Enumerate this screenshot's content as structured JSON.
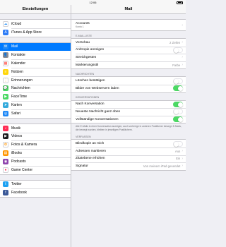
{
  "status": {
    "time": "12:06"
  },
  "sidebar": {
    "title": "Einstellungen",
    "groups": [
      [
        {
          "label": "iCloud",
          "color": "#ffffff",
          "icon": "cloud-icon",
          "glyph": "☁",
          "fg": "#3f9cf6"
        },
        {
          "label": "iTunes & App Store",
          "color": "#2e7cf6",
          "icon": "app-store-icon",
          "glyph": "A",
          "fg": "#ffffff"
        }
      ],
      [
        {
          "label": "Mail",
          "color": "#1e88f7",
          "icon": "mail-icon",
          "glyph": "✉",
          "fg": "#ffffff",
          "selected": true
        },
        {
          "label": "Kontakte",
          "color": "#8e8e93",
          "icon": "contacts-icon",
          "glyph": "👤",
          "fg": "#ffffff"
        },
        {
          "label": "Kalender",
          "color": "#ffffff",
          "icon": "calendar-icon",
          "glyph": "▦",
          "fg": "#ff3b30"
        },
        {
          "label": "Notizen",
          "color": "#ffd60a",
          "icon": "notes-icon",
          "glyph": "≡",
          "fg": "#ffffff"
        },
        {
          "label": "Erinnerungen",
          "color": "#ffffff",
          "icon": "reminders-icon",
          "glyph": "⋮",
          "fg": "#ff9500"
        },
        {
          "label": "Nachrichten",
          "color": "#4cd964",
          "icon": "messages-icon",
          "glyph": "💬",
          "fg": "#ffffff"
        },
        {
          "label": "FaceTime",
          "color": "#4cd964",
          "icon": "facetime-icon",
          "glyph": "▶",
          "fg": "#ffffff"
        },
        {
          "label": "Karten",
          "color": "#34aadc",
          "icon": "maps-icon",
          "glyph": "➤",
          "fg": "#ffffff"
        },
        {
          "label": "Safari",
          "color": "#1e88f7",
          "icon": "safari-icon",
          "glyph": "◎",
          "fg": "#ffffff"
        }
      ],
      [
        {
          "label": "Musik",
          "color": "#ff2d55",
          "icon": "music-icon",
          "glyph": "♪",
          "fg": "#ffffff"
        },
        {
          "label": "Videos",
          "color": "#1c1c1e",
          "icon": "videos-icon",
          "glyph": "▶",
          "fg": "#ffffff"
        },
        {
          "label": "Fotos & Kamera",
          "color": "#ffffff",
          "icon": "photos-icon",
          "glyph": "✿",
          "fg": "#ff9500"
        },
        {
          "label": "iBooks",
          "color": "#ff9500",
          "icon": "ibooks-icon",
          "glyph": "▤",
          "fg": "#ffffff"
        },
        {
          "label": "Podcasts",
          "color": "#8e44ad",
          "icon": "podcasts-icon",
          "glyph": "◉",
          "fg": "#ffffff"
        },
        {
          "label": "Game Center",
          "color": "#ffffff",
          "icon": "game-center-icon",
          "glyph": "●",
          "fg": "#ff2d55"
        }
      ],
      [
        {
          "label": "Twitter",
          "color": "#1da1f2",
          "icon": "twitter-icon",
          "glyph": "t",
          "fg": "#ffffff"
        },
        {
          "label": "Facebook",
          "color": "#3b5998",
          "icon": "facebook-icon",
          "glyph": "f",
          "fg": "#ffffff"
        }
      ]
    ]
  },
  "detail": {
    "title": "Mail",
    "accounts": {
      "label": "Accounts",
      "sub": "Konto 1"
    },
    "sections": {
      "email_list": "E-MAIL-LISTE",
      "messages": "NACHRICHTEN",
      "conversations": "KONVERSATIONEN",
      "compose": "VERFASSEN"
    },
    "email_list": [
      {
        "label": "Vorschau",
        "value": "2 Zeilen",
        "type": "nav"
      },
      {
        "label": "An/Kopie anzeigen",
        "type": "toggle",
        "on": false
      },
      {
        "label": "Streichgesten",
        "type": "nav",
        "value": ""
      },
      {
        "label": "Markierungsstil",
        "value": "Farbe",
        "type": "nav"
      }
    ],
    "messages": [
      {
        "label": "Löschen bestätigen",
        "type": "toggle",
        "on": false
      },
      {
        "label": "Bilder von Webservern laden",
        "type": "toggle",
        "on": true
      }
    ],
    "conversations": [
      {
        "label": "Nach Konversation",
        "type": "toggle",
        "on": true
      },
      {
        "label": "Neueste Nachricht ganz oben",
        "type": "toggle",
        "on": false
      },
      {
        "label": "Vollständige Konversationen",
        "type": "toggle",
        "on": true
      }
    ],
    "conversations_footnote": "Alle E-Mails in einer Konversation anzeigen, auch vorherige in anderen Postfächer bewegt. E-Mails, die bewegt wurden, bleiben in jeweiligen Postfächern.",
    "compose": [
      {
        "label": "Blindkopie an mich",
        "type": "toggle",
        "on": false
      },
      {
        "label": "Adressen markieren",
        "value": "Aus",
        "type": "nav"
      },
      {
        "label": "Zitatebene erhöhen",
        "value": "Ein",
        "type": "nav"
      },
      {
        "label": "Signatur",
        "value": "Von meinem iPad gesendet",
        "type": "nav"
      }
    ]
  }
}
